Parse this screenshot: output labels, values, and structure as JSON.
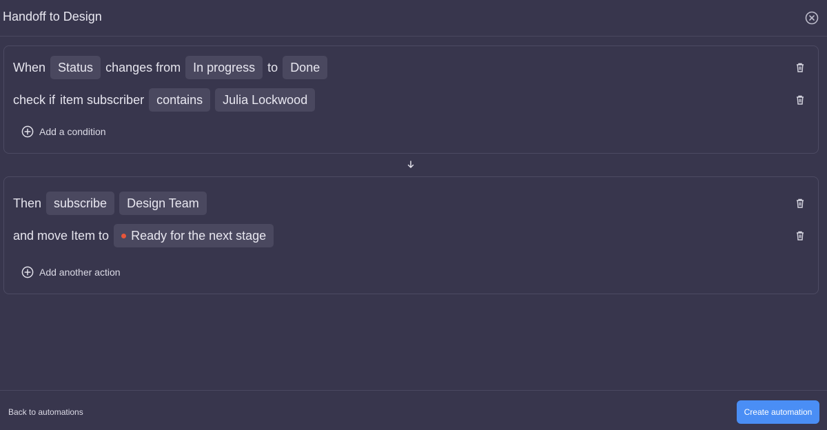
{
  "header": {
    "title": "Handoff to Design",
    "close_icon": "close-circle-icon"
  },
  "trigger": {
    "row1": {
      "when": "When",
      "field": "Status",
      "changes_from": "changes from",
      "from_value": "In progress",
      "to": "to",
      "to_value": "Done"
    },
    "row2": {
      "check_if": "check if",
      "subject": "item subscriber",
      "operator": "contains",
      "value": "Julia Lockwood"
    },
    "add_condition": "Add a condition"
  },
  "action": {
    "row1": {
      "then": "Then",
      "verb": "subscribe",
      "target": "Design Team"
    },
    "row2": {
      "label": "and move Item to",
      "stage": "Ready for the next stage",
      "stage_color": "#e8563a"
    },
    "add_action": "Add another action"
  },
  "footer": {
    "back": "Back to automations",
    "create": "Create automation"
  },
  "colors": {
    "background": "#38364d",
    "chip": "#4a485f",
    "accent": "#4a8ef5"
  }
}
